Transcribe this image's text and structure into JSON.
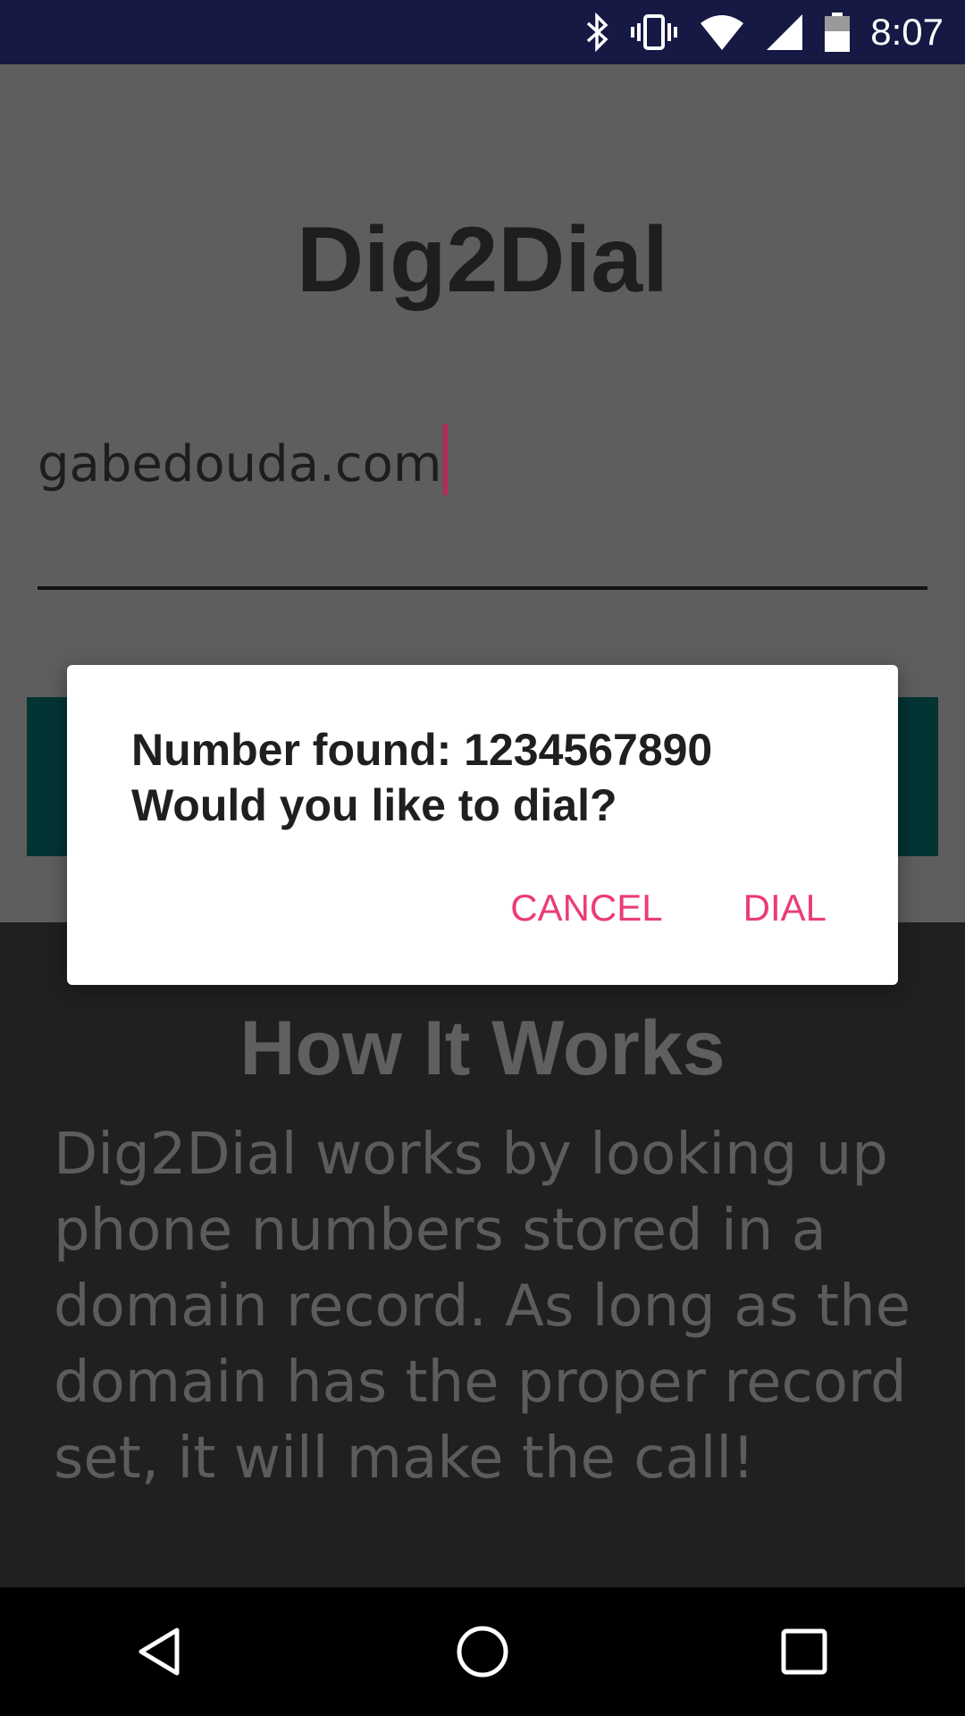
{
  "status_bar": {
    "time": "8:07",
    "icons": [
      "bluetooth-icon",
      "vibrate-icon",
      "wifi-icon",
      "cell-signal-icon",
      "battery-icon"
    ]
  },
  "app": {
    "title": "Dig2Dial",
    "domain_input": {
      "value": "gabedouda.com"
    }
  },
  "info": {
    "heading": "How It Works",
    "body": "Dig2Dial works by looking up phone numbers stored in a domain record. As long as the domain has the proper record set, it will make the call!"
  },
  "dialog": {
    "message": "Number found: 1234567890\nWould you like to dial?",
    "cancel_label": "CANCEL",
    "dial_label": "DIAL"
  },
  "nav_bar": {
    "icons": [
      "back-icon",
      "home-icon",
      "recents-icon"
    ]
  },
  "colors": {
    "status_bar": "#161944",
    "accent": "#eb3c78",
    "button": "#023433",
    "info_background": "#202020"
  }
}
